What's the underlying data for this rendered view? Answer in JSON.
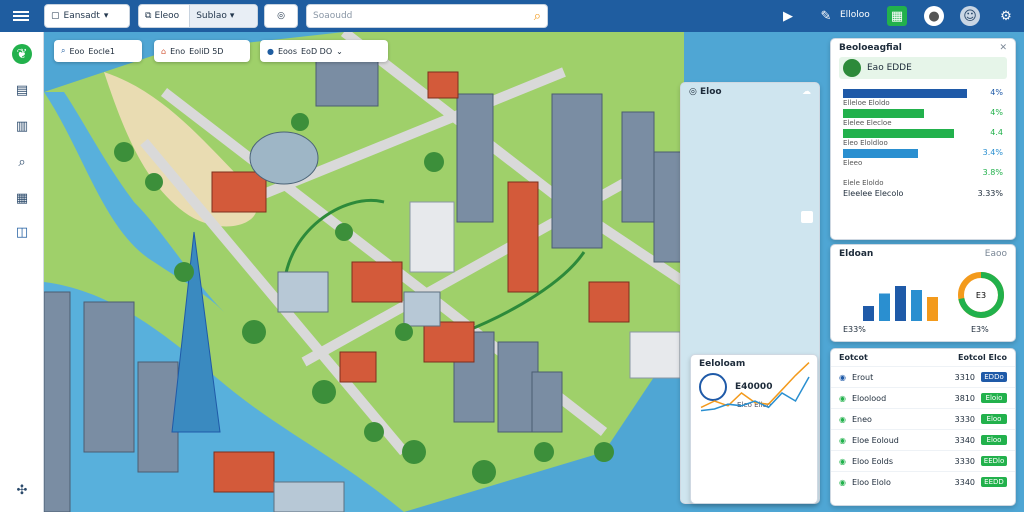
{
  "topbar": {
    "workspace": "Eansadt",
    "filter_a": "Eleoo",
    "filter_b": "Sublao",
    "search_placeholder": "Soaoudd",
    "user_label": "Elloloo"
  },
  "chips": [
    {
      "label": "Eoo",
      "value": "Eocle1"
    },
    {
      "label": "Eno",
      "value": "EoliD 5D"
    },
    {
      "label": "Eoos",
      "value": "EoD DO"
    }
  ],
  "analytics": {
    "title": "Beoloeagfial",
    "header_value": "Eao EDDE",
    "rows": [
      {
        "label": "Elleloe Eloldo",
        "value": "4%",
        "pct": 0.95,
        "color": "#1f5aa8"
      },
      {
        "label": "Elelee Elecloe",
        "value": "4%",
        "pct": 0.62,
        "color": "#22b14c"
      },
      {
        "label": "Eleo Eloldloo",
        "value": "4.4",
        "pct": 0.85,
        "color": "#22b14c"
      },
      {
        "label": "Eleeo",
        "value": "3.4%",
        "pct": 0.58,
        "color": "#2a8fd0"
      },
      {
        "label": "Elele Eloldo",
        "value": "3.8%",
        "pct": 0.0,
        "color": "#22b14c"
      }
    ],
    "footer_label": "Eleelee Elecolo",
    "footer_value": "3.33%"
  },
  "minimap": {
    "title": "Eloo"
  },
  "stats": {
    "title": "Eldoan",
    "sub": "Eaoo",
    "bars": [
      0.3,
      0.55,
      0.7,
      0.62,
      0.48
    ],
    "bar_colors": [
      "#1f5aa8",
      "#2a8fd0",
      "#1f5aa8",
      "#2a8fd0",
      "#f39a1c"
    ],
    "donut_value": "E3",
    "donut_pct": 0.72,
    "footer_value": "E33%",
    "donut_footer": "E3%"
  },
  "trend": {
    "title": "Eeloloam",
    "value": "E40000",
    "axis": "Eleo Elloo",
    "series": [
      {
        "name": "",
        "values": [
          22,
          30,
          24,
          40,
          28,
          26,
          44,
          62,
          78
        ]
      },
      {
        "name": "",
        "values": [
          18,
          20,
          26,
          24,
          30,
          22,
          40,
          30,
          60
        ]
      }
    ]
  },
  "list": {
    "header": {
      "name": "Eotcot",
      "c1": "Eotcol",
      "c2": "Elco"
    },
    "rows": [
      {
        "name": "Erout",
        "value": "3310",
        "badge": "EDDo",
        "color": "#1f5aa8"
      },
      {
        "name": "Eloolood",
        "value": "3810",
        "badge": "Eloio",
        "color": "#22b14c"
      },
      {
        "name": "Eneo",
        "value": "3330",
        "badge": "Eloo",
        "color": "#22b14c"
      },
      {
        "name": "Eloe Eoloud",
        "value": "3340",
        "badge": "Eloo",
        "color": "#22b14c"
      },
      {
        "name": "Eloo Eolds",
        "value": "3330",
        "badge": "EEDlo",
        "color": "#22b14c"
      },
      {
        "name": "Eloo Elolo",
        "value": "3340",
        "badge": "EEDD",
        "color": "#22b14c"
      }
    ]
  }
}
